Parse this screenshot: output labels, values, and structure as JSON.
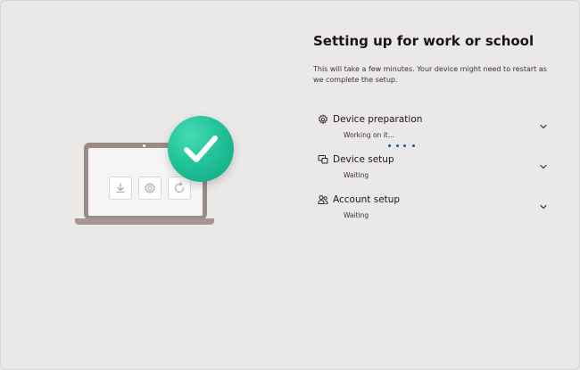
{
  "header": {
    "title": "Setting up for work or school",
    "subtitle": "This will take a few minutes. Your device might need to restart as we complete the setup."
  },
  "steps": [
    {
      "icon": "gear-icon",
      "title": "Device preparation",
      "status": "Working on it...",
      "expanded": false
    },
    {
      "icon": "devices-icon",
      "title": "Device setup",
      "status": "Waiting",
      "expanded": false
    },
    {
      "icon": "people-icon",
      "title": "Account setup",
      "status": "Waiting",
      "expanded": false
    }
  ],
  "illustration": {
    "laptop_icons": [
      "download-icon",
      "gear-icon",
      "restart-icon"
    ],
    "badge_icon": "checkmark-icon"
  },
  "colors": {
    "background": "#ebe8e8",
    "accent_green": "#22c39a",
    "progress_blue": "#1f5fa8",
    "laptop": "#9b8a86"
  }
}
